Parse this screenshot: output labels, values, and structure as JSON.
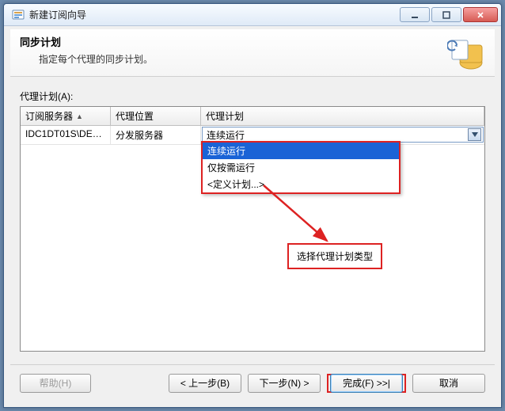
{
  "window": {
    "title": "新建订阅向导"
  },
  "header": {
    "title": "同步计划",
    "subtitle": "指定每个代理的同步计划。"
  },
  "grid": {
    "label": "代理计划(A):",
    "cols": {
      "sub": "订阅服务器",
      "loc": "代理位置",
      "plan": "代理计划"
    },
    "row": {
      "sub": "IDC1DT01S\\DEV...",
      "loc": "分发服务器",
      "plan_value": "连续运行"
    },
    "options": [
      "连续运行",
      "仅按需运行",
      "<定义计划...>"
    ]
  },
  "callout": {
    "text": "选择代理计划类型"
  },
  "footer": {
    "help": "帮助(H)",
    "back": "< 上一步(B)",
    "next": "下一步(N) >",
    "finish": "完成(F) >>|",
    "cancel": "取消"
  }
}
